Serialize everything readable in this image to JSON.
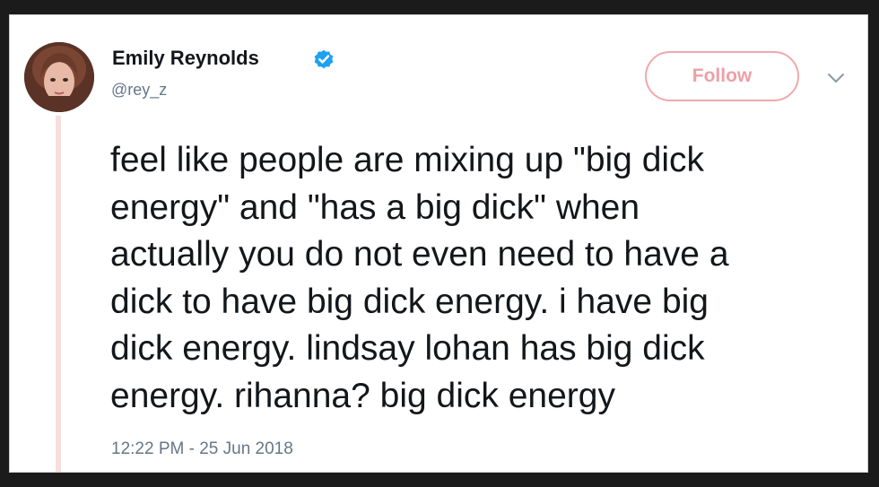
{
  "tweet": {
    "author": {
      "display_name": "Emily Reynolds",
      "handle": "@rey_z",
      "verified": true,
      "avatar_icon": "profile-photo"
    },
    "follow_label": "Follow",
    "text": "feel like people are mixing up \"big dick\nenergy\" and \"has a big dick\" when\nactually you do not even need to have a\ndick to have big dick energy. i have big\ndick energy. lindsay lohan has big dick\nenergy. rihanna? big dick energy",
    "timestamp": "12:22 PM - 25 Jun 2018"
  },
  "colors": {
    "follow_border": "#f0a8ad",
    "follow_text": "#eda0a6",
    "verified_badge": "#1da1f2",
    "thread_line": "#f6dede",
    "meta_text": "#657786",
    "text": "#14171a"
  },
  "icons": {
    "verified": "verified-badge-icon",
    "more": "chevron-down-icon"
  }
}
